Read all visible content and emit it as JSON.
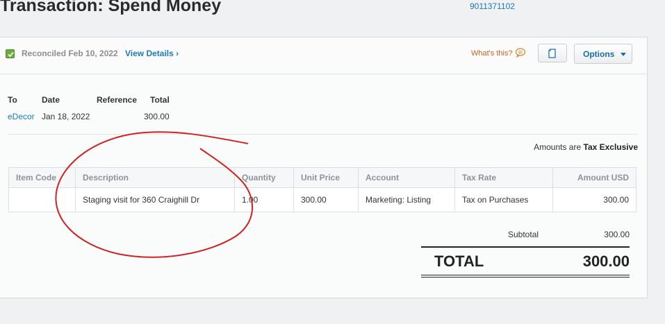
{
  "header": {
    "title": "Transaction: Spend Money",
    "account_number": "9011371102"
  },
  "status": {
    "reconciled": "Reconciled Feb 10, 2022",
    "view_details": "View Details ›",
    "whats_this": "What's this?",
    "options_label": "Options"
  },
  "summary": {
    "labels": [
      "To",
      "Date",
      "Reference",
      "Total"
    ],
    "to": "eDecor",
    "date": "Jan 18, 2022",
    "reference": "",
    "total": "300.00"
  },
  "tax_mode": {
    "prefix": "Amounts are",
    "value": "Tax Exclusive"
  },
  "line_items": {
    "columns": [
      "Item Code",
      "Description",
      "Quantity",
      "Unit Price",
      "Account",
      "Tax Rate",
      "Amount USD"
    ],
    "rows": [
      {
        "item_code": "",
        "description": "Staging visit for 360 Craighill Dr",
        "quantity": "1.00",
        "unit_price": "300.00",
        "account": "Marketing: Listing",
        "tax_rate": "Tax on Purchases",
        "amount": "300.00"
      }
    ]
  },
  "totals": {
    "subtotal_label": "Subtotal",
    "subtotal_value": "300.00",
    "total_label": "TOTAL",
    "total_value": "300.00"
  },
  "colors": {
    "link": "#1a7ab8",
    "annotation": "#d42020",
    "reconciled_check": "#6aae3e"
  },
  "icons": [
    "check-icon",
    "comment-icon",
    "document-icon",
    "caret-down-icon"
  ]
}
